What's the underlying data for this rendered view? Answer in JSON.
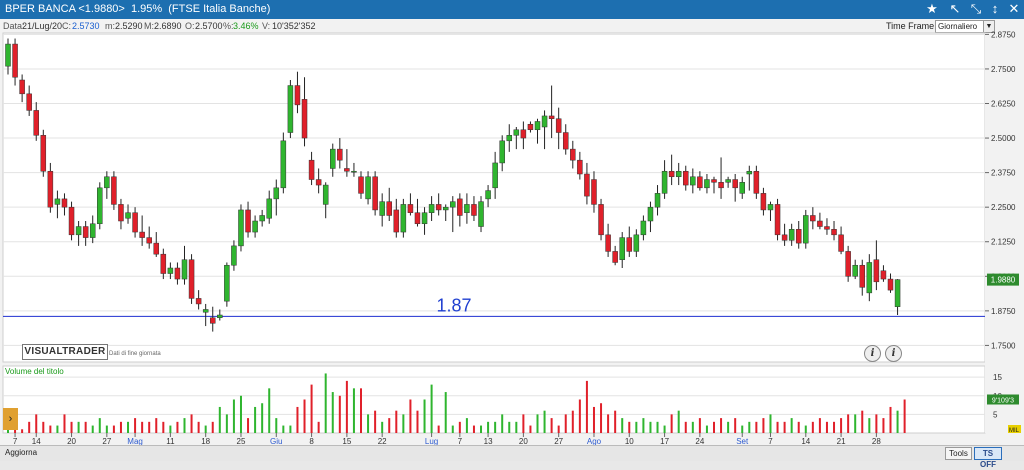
{
  "window": {
    "title": "BPER BANCA <1.9880>  1.95%  (FTSE Italia Banche)"
  },
  "infobar": {
    "data_label": "Data:",
    "data_value": "21/Lug/20",
    "c_label": "C:",
    "c_value": "2.5730",
    "m_label": "m:",
    "m_value": "2.5290",
    "M_label": "M:",
    "M_value": "2.6890",
    "o_label": "O:",
    "o_value": "2.5700",
    "pct_label": "%:",
    "pct_value": "3.46%",
    "v_label": "V:",
    "v_value": "10'352'352"
  },
  "timeframe": {
    "label": "Time Frame",
    "selected": "Giornaliero"
  },
  "branding": {
    "logo_text": "VISUALTRADER",
    "subtitle": "Dati di fine giornata"
  },
  "volume_panel": {
    "title": "Volume del titolo",
    "last_value_label": "9'109'3"
  },
  "bottombar": {
    "aggiorna": "Aggiorna",
    "tools": "Tools",
    "ts_off": "TS OFF",
    "mil_label": "MIL"
  },
  "colors": {
    "up": "#2fb52f",
    "down": "#e0202a",
    "line": "#1f2fd0",
    "titlebar": "#1d6fb0",
    "price_tag": "#2e8b2e"
  },
  "chart_data": {
    "type": "candlestick",
    "price_axis": {
      "ylim": [
        1.69,
        2.88
      ],
      "ticks": [
        "2.8750",
        "2.7500",
        "2.6250",
        "2.5000",
        "2.3750",
        "2.2500",
        "2.1250",
        "2.0000",
        "1.8750",
        "1.7500"
      ]
    },
    "volume_axis": {
      "ylim": [
        0,
        18
      ],
      "ticks": [
        "15",
        "10",
        "5"
      ]
    },
    "x_tick_labels": [
      {
        "i": 1,
        "label": "7"
      },
      {
        "i": 4,
        "label": "14"
      },
      {
        "i": 9,
        "label": "20"
      },
      {
        "i": 14,
        "label": "27"
      },
      {
        "i": 18,
        "label": "Mag"
      },
      {
        "i": 23,
        "label": "11"
      },
      {
        "i": 28,
        "label": "18"
      },
      {
        "i": 33,
        "label": "25"
      },
      {
        "i": 38,
        "label": "Giu"
      },
      {
        "i": 43,
        "label": "8"
      },
      {
        "i": 48,
        "label": "15"
      },
      {
        "i": 53,
        "label": "22"
      },
      {
        "i": 60,
        "label": "Lug"
      },
      {
        "i": 64,
        "label": "7"
      },
      {
        "i": 68,
        "label": "13"
      },
      {
        "i": 73,
        "label": "20"
      },
      {
        "i": 78,
        "label": "27"
      },
      {
        "i": 83,
        "label": "Ago"
      },
      {
        "i": 88,
        "label": "10"
      },
      {
        "i": 93,
        "label": "17"
      },
      {
        "i": 98,
        "label": "24"
      },
      {
        "i": 104,
        "label": "Set"
      },
      {
        "i": 108,
        "label": "7"
      },
      {
        "i": 113,
        "label": "14"
      },
      {
        "i": 118,
        "label": "21"
      },
      {
        "i": 123,
        "label": "28"
      }
    ],
    "highlight_month_labels": [
      "Mag",
      "Giu",
      "Lug",
      "Ago",
      "Set"
    ],
    "support_line": {
      "value": 1.855,
      "label": "1.87"
    },
    "last_price_label": "1.9880",
    "candles": [
      [
        2.76,
        2.86,
        2.73,
        2.84
      ],
      [
        2.84,
        2.86,
        2.69,
        2.72
      ],
      [
        2.71,
        2.73,
        2.63,
        2.66
      ],
      [
        2.66,
        2.69,
        2.58,
        2.6
      ],
      [
        2.6,
        2.63,
        2.49,
        2.51
      ],
      [
        2.51,
        2.53,
        2.36,
        2.38
      ],
      [
        2.38,
        2.41,
        2.23,
        2.25
      ],
      [
        2.26,
        2.31,
        2.21,
        2.28
      ],
      [
        2.28,
        2.3,
        2.22,
        2.25
      ],
      [
        2.25,
        2.27,
        2.13,
        2.15
      ],
      [
        2.15,
        2.2,
        2.11,
        2.18
      ],
      [
        2.18,
        2.2,
        2.11,
        2.14
      ],
      [
        2.14,
        2.22,
        2.12,
        2.19
      ],
      [
        2.19,
        2.34,
        2.17,
        2.32
      ],
      [
        2.32,
        2.38,
        2.28,
        2.36
      ],
      [
        2.36,
        2.38,
        2.24,
        2.26
      ],
      [
        2.26,
        2.28,
        2.17,
        2.2
      ],
      [
        2.21,
        2.26,
        2.19,
        2.23
      ],
      [
        2.23,
        2.25,
        2.14,
        2.16
      ],
      [
        2.16,
        2.22,
        2.11,
        2.14
      ],
      [
        2.14,
        2.18,
        2.1,
        2.12
      ],
      [
        2.12,
        2.16,
        2.07,
        2.08
      ],
      [
        2.08,
        2.1,
        1.99,
        2.01
      ],
      [
        2.01,
        2.05,
        1.99,
        2.03
      ],
      [
        2.03,
        2.05,
        1.97,
        1.99
      ],
      [
        1.99,
        2.11,
        1.97,
        2.06
      ],
      [
        2.06,
        2.08,
        1.9,
        1.92
      ],
      [
        1.92,
        1.95,
        1.88,
        1.9
      ],
      [
        1.87,
        1.9,
        1.82,
        1.88
      ],
      [
        1.85,
        1.89,
        1.8,
        1.83
      ],
      [
        1.85,
        1.88,
        1.84,
        1.86
      ],
      [
        1.91,
        2.05,
        1.89,
        2.04
      ],
      [
        2.04,
        2.13,
        2.02,
        2.11
      ],
      [
        2.11,
        2.26,
        2.09,
        2.24
      ],
      [
        2.24,
        2.27,
        2.14,
        2.16
      ],
      [
        2.16,
        2.22,
        2.14,
        2.2
      ],
      [
        2.2,
        2.24,
        2.18,
        2.22
      ],
      [
        2.21,
        2.31,
        2.19,
        2.28
      ],
      [
        2.28,
        2.35,
        2.22,
        2.32
      ],
      [
        2.32,
        2.52,
        2.3,
        2.49
      ],
      [
        2.52,
        2.71,
        2.5,
        2.69
      ],
      [
        2.69,
        2.74,
        2.59,
        2.62
      ],
      [
        2.64,
        2.72,
        2.47,
        2.5
      ],
      [
        2.42,
        2.45,
        2.33,
        2.35
      ],
      [
        2.35,
        2.39,
        2.3,
        2.33
      ],
      [
        2.26,
        2.34,
        2.21,
        2.33
      ],
      [
        2.39,
        2.48,
        2.36,
        2.46
      ],
      [
        2.46,
        2.5,
        2.39,
        2.42
      ],
      [
        2.39,
        2.46,
        2.36,
        2.38
      ],
      [
        2.38,
        2.41,
        2.36,
        2.38
      ],
      [
        2.36,
        2.38,
        2.28,
        2.3
      ],
      [
        2.28,
        2.38,
        2.26,
        2.36
      ],
      [
        2.36,
        2.38,
        2.22,
        2.24
      ],
      [
        2.22,
        2.3,
        2.18,
        2.27
      ],
      [
        2.27,
        2.32,
        2.2,
        2.22
      ],
      [
        2.24,
        2.28,
        2.14,
        2.16
      ],
      [
        2.16,
        2.28,
        2.14,
        2.26
      ],
      [
        2.26,
        2.3,
        2.22,
        2.23
      ],
      [
        2.23,
        2.28,
        2.18,
        2.19
      ],
      [
        2.19,
        2.25,
        2.15,
        2.23
      ],
      [
        2.23,
        2.29,
        2.2,
        2.26
      ],
      [
        2.26,
        2.3,
        2.22,
        2.24
      ],
      [
        2.24,
        2.26,
        2.2,
        2.25
      ],
      [
        2.25,
        2.29,
        2.16,
        2.27
      ],
      [
        2.28,
        2.3,
        2.18,
        2.22
      ],
      [
        2.23,
        2.3,
        2.19,
        2.26
      ],
      [
        2.26,
        2.29,
        2.2,
        2.22
      ],
      [
        2.18,
        2.29,
        2.16,
        2.27
      ],
      [
        2.28,
        2.33,
        2.25,
        2.31
      ],
      [
        2.32,
        2.45,
        2.28,
        2.41
      ],
      [
        2.41,
        2.51,
        2.38,
        2.49
      ],
      [
        2.49,
        2.55,
        2.45,
        2.51
      ],
      [
        2.51,
        2.54,
        2.46,
        2.53
      ],
      [
        2.53,
        2.56,
        2.46,
        2.5
      ],
      [
        2.55,
        2.56,
        2.52,
        2.53
      ],
      [
        2.53,
        2.57,
        2.48,
        2.56
      ],
      [
        2.54,
        2.6,
        2.46,
        2.58
      ],
      [
        2.58,
        2.69,
        2.5,
        2.57
      ],
      [
        2.57,
        2.61,
        2.46,
        2.52
      ],
      [
        2.52,
        2.55,
        2.44,
        2.46
      ],
      [
        2.46,
        2.49,
        2.39,
        2.42
      ],
      [
        2.42,
        2.45,
        2.35,
        2.37
      ],
      [
        2.37,
        2.41,
        2.26,
        2.29
      ],
      [
        2.35,
        2.38,
        2.23,
        2.26
      ],
      [
        2.26,
        2.28,
        2.13,
        2.15
      ],
      [
        2.15,
        2.19,
        2.07,
        2.09
      ],
      [
        2.09,
        2.11,
        2.04,
        2.05
      ],
      [
        2.06,
        2.16,
        2.03,
        2.14
      ],
      [
        2.14,
        2.18,
        2.07,
        2.09
      ],
      [
        2.09,
        2.17,
        2.07,
        2.15
      ],
      [
        2.15,
        2.22,
        2.13,
        2.2
      ],
      [
        2.2,
        2.27,
        2.16,
        2.25
      ],
      [
        2.25,
        2.33,
        2.22,
        2.3
      ],
      [
        2.3,
        2.42,
        2.28,
        2.38
      ],
      [
        2.38,
        2.44,
        2.33,
        2.36
      ],
      [
        2.36,
        2.41,
        2.33,
        2.38
      ],
      [
        2.38,
        2.4,
        2.31,
        2.33
      ],
      [
        2.33,
        2.39,
        2.3,
        2.36
      ],
      [
        2.36,
        2.38,
        2.31,
        2.32
      ],
      [
        2.32,
        2.37,
        2.3,
        2.35
      ],
      [
        2.35,
        2.36,
        2.3,
        2.34
      ],
      [
        2.34,
        2.43,
        2.28,
        2.32
      ],
      [
        2.34,
        2.36,
        2.32,
        2.35
      ],
      [
        2.35,
        2.37,
        2.27,
        2.32
      ],
      [
        2.3,
        2.36,
        2.28,
        2.34
      ],
      [
        2.37,
        2.4,
        2.31,
        2.38
      ],
      [
        2.38,
        2.4,
        2.28,
        2.3
      ],
      [
        2.3,
        2.32,
        2.22,
        2.24
      ],
      [
        2.24,
        2.27,
        2.2,
        2.26
      ],
      [
        2.26,
        2.28,
        2.13,
        2.15
      ],
      [
        2.15,
        2.19,
        2.11,
        2.13
      ],
      [
        2.13,
        2.19,
        2.11,
        2.17
      ],
      [
        2.17,
        2.2,
        2.1,
        2.12
      ],
      [
        2.12,
        2.24,
        2.1,
        2.22
      ],
      [
        2.22,
        2.25,
        2.17,
        2.2
      ],
      [
        2.2,
        2.23,
        2.17,
        2.18
      ],
      [
        2.18,
        2.21,
        2.15,
        2.17
      ],
      [
        2.17,
        2.2,
        2.13,
        2.15
      ],
      [
        2.15,
        2.18,
        2.08,
        2.09
      ],
      [
        2.09,
        2.11,
        1.98,
        2.0
      ],
      [
        2.0,
        2.06,
        1.99,
        2.04
      ],
      [
        2.04,
        2.06,
        1.93,
        1.96
      ],
      [
        1.94,
        2.08,
        1.91,
        2.05
      ],
      [
        2.06,
        2.13,
        1.95,
        1.98
      ],
      [
        2.02,
        2.04,
        1.98,
        1.99
      ],
      [
        1.99,
        2.01,
        1.94,
        1.95
      ],
      [
        1.89,
        1.99,
        1.86,
        1.988
      ]
    ],
    "volumes": [
      4,
      2,
      1,
      3,
      5,
      3,
      2,
      2,
      5,
      3,
      3,
      3,
      2,
      4,
      2,
      2,
      3,
      3,
      4,
      3,
      3,
      4,
      3,
      2,
      3,
      4,
      5,
      3,
      2,
      3,
      7,
      5,
      9,
      10,
      4,
      7,
      8,
      12,
      4,
      2,
      2,
      7,
      9,
      13,
      3,
      16,
      11,
      10,
      14,
      12,
      12,
      5,
      6,
      3,
      4,
      6,
      5,
      9,
      6,
      9,
      13,
      2,
      11,
      2,
      3,
      4,
      2,
      2,
      3,
      3,
      5,
      3,
      3,
      5,
      2,
      5,
      6,
      4,
      2,
      5,
      6,
      9,
      14,
      7,
      8,
      5,
      6,
      4,
      3,
      3,
      4,
      3,
      3,
      2,
      5,
      6,
      3,
      3,
      4,
      2,
      3,
      4,
      3,
      4,
      2,
      3,
      3,
      4,
      5,
      3,
      3,
      4,
      3,
      2,
      3,
      4,
      3,
      3,
      4,
      5,
      5,
      6,
      4,
      5,
      4,
      7,
      6,
      9
    ]
  }
}
